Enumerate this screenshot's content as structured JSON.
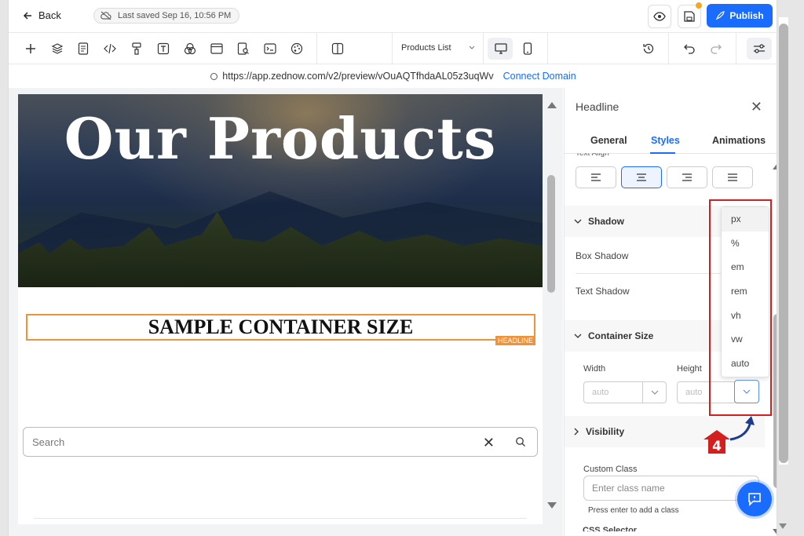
{
  "topbar": {
    "back_label": "Back",
    "saved_text": "Last saved Sep 16, 10:56 PM",
    "publish_label": "Publish"
  },
  "toolbar": {
    "page_selector": "Products List"
  },
  "urlbar": {
    "url": "https://app.zednow.com/v2/preview/vOuAQTfhdaAL05z3uqWv",
    "connect_label": "Connect Domain"
  },
  "canvas": {
    "hero_title": "Our Products",
    "headline_text": "SAMPLE CONTAINER SIZE",
    "headline_tag": "HEADLINE",
    "search_placeholder": "Search"
  },
  "panel": {
    "title": "Headline",
    "tabs": [
      {
        "label": "General"
      },
      {
        "label": "Styles"
      },
      {
        "label": "Animations"
      }
    ],
    "text_align_label": "Text Align",
    "shadow_section": "Shadow",
    "box_shadow_label": "Box Shadow",
    "text_shadow_label": "Text Shadow",
    "container_size_section": "Container Size",
    "width_label": "Width",
    "height_label": "Height",
    "width_value": "auto",
    "height_value": "auto",
    "visibility_section": "Visibility",
    "custom_class_label": "Custom Class",
    "custom_class_placeholder": "Enter class name",
    "press_enter_hint": "Press enter to add a class",
    "css_selector_label": "CSS Selector"
  },
  "unit_menu": {
    "options": [
      "px",
      "%",
      "em",
      "rem",
      "vh",
      "vw",
      "auto"
    ],
    "selected": "px"
  },
  "annotation": {
    "step_number": "4",
    "frame_color": "#d3201f",
    "badge_color": "#d3201f"
  },
  "colors": {
    "accent": "#1a6bff",
    "headline_outline": "#f0923a",
    "notify_dot": "#f5a623"
  }
}
